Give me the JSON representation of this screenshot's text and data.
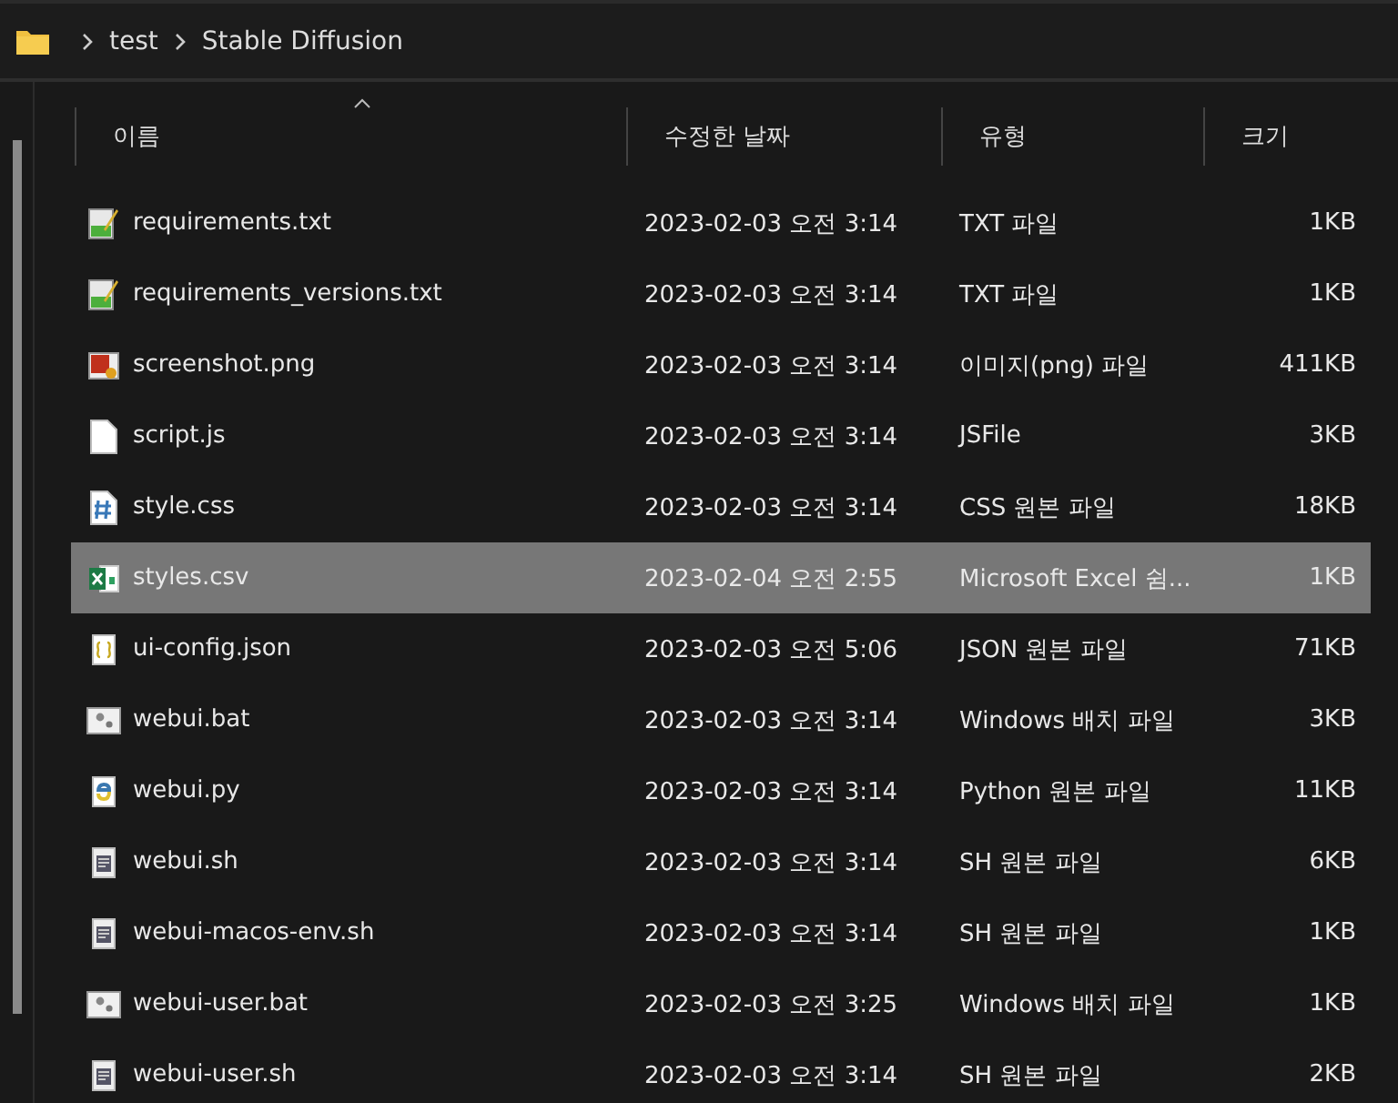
{
  "breadcrumb": [
    "test",
    "Stable Diffusion"
  ],
  "columns": [
    "이름",
    "수정한 날짜",
    "유형",
    "크기"
  ],
  "rows": [
    {
      "name": "requirements.txt",
      "date": "2023-02-03 오전 3:14",
      "type": "TXT 파일",
      "size": "1KB",
      "kind": "text",
      "selected": false
    },
    {
      "name": "requirements_versions.txt",
      "date": "2023-02-03 오전 3:14",
      "type": "TXT 파일",
      "size": "1KB",
      "kind": "text",
      "selected": false
    },
    {
      "name": "screenshot.png",
      "date": "2023-02-03 오전 3:14",
      "type": "이미지(png) 파일",
      "size": "411KB",
      "kind": "image",
      "selected": false
    },
    {
      "name": "script.js",
      "date": "2023-02-03 오전 3:14",
      "type": "JSFile",
      "size": "3KB",
      "kind": "blank",
      "selected": false
    },
    {
      "name": "style.css",
      "date": "2023-02-03 오전 3:14",
      "type": "CSS 원본 파일",
      "size": "18KB",
      "kind": "css",
      "selected": false
    },
    {
      "name": "styles.csv",
      "date": "2023-02-04 오전 2:55",
      "type": "Microsoft Excel 쉼...",
      "size": "1KB",
      "kind": "excel",
      "selected": true
    },
    {
      "name": "ui-config.json",
      "date": "2023-02-03 오전 5:06",
      "type": "JSON 원본 파일",
      "size": "71KB",
      "kind": "json",
      "selected": false
    },
    {
      "name": "webui.bat",
      "date": "2023-02-03 오전 3:14",
      "type": "Windows 배치 파일",
      "size": "3KB",
      "kind": "batch",
      "selected": false
    },
    {
      "name": "webui.py",
      "date": "2023-02-03 오전 3:14",
      "type": "Python 원본 파일",
      "size": "11KB",
      "kind": "python",
      "selected": false
    },
    {
      "name": "webui.sh",
      "date": "2023-02-03 오전 3:14",
      "type": "SH 원본 파일",
      "size": "6KB",
      "kind": "script",
      "selected": false
    },
    {
      "name": "webui-macos-env.sh",
      "date": "2023-02-03 오전 3:14",
      "type": "SH 원본 파일",
      "size": "1KB",
      "kind": "script",
      "selected": false
    },
    {
      "name": "webui-user.bat",
      "date": "2023-02-03 오전 3:25",
      "type": "Windows 배치 파일",
      "size": "1KB",
      "kind": "batch",
      "selected": false
    },
    {
      "name": "webui-user.sh",
      "date": "2023-02-03 오전 3:14",
      "type": "SH 원본 파일",
      "size": "2KB",
      "kind": "script",
      "selected": false
    }
  ]
}
